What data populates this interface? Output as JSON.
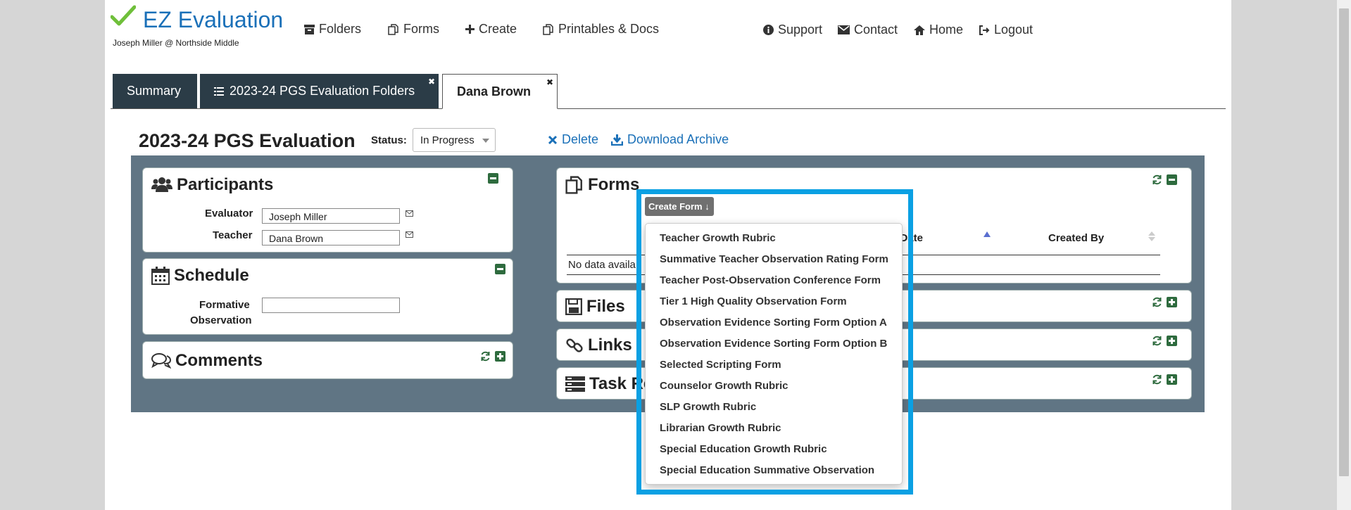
{
  "app": {
    "name": "EZ Evaluation",
    "user_line": "Joseph Miller @ Northside Middle",
    "brand_color": "#1a70b8"
  },
  "nav": {
    "left": [
      {
        "label": "Folders",
        "icon": "archive-icon"
      },
      {
        "label": "Forms",
        "icon": "copy-icon"
      },
      {
        "label": "Create",
        "icon": "plus-icon"
      },
      {
        "label": "Printables & Docs",
        "icon": "copy-icon"
      }
    ],
    "right": [
      {
        "label": "Support",
        "icon": "info-circle-icon"
      },
      {
        "label": "Contact",
        "icon": "envelope-icon"
      },
      {
        "label": "Home",
        "icon": "home-icon"
      },
      {
        "label": "Logout",
        "icon": "logout-icon"
      }
    ]
  },
  "tabs": [
    {
      "label": "Summary",
      "active": false
    },
    {
      "label": "2023-24 PGS Evaluation Folders",
      "active": false,
      "closable": true
    },
    {
      "label": "Dana Brown",
      "active": true,
      "closable": true
    }
  ],
  "evaluation": {
    "title": "2023-24 PGS Evaluation",
    "status_label": "Status:",
    "status_value": "In Progress",
    "delete_label": "Delete",
    "download_label": "Download Archive"
  },
  "participants": {
    "title": "Participants",
    "evaluator_label": "Evaluator",
    "evaluator_value": "Joseph Miller",
    "teacher_label": "Teacher",
    "teacher_value": "Dana Brown"
  },
  "schedule": {
    "title": "Schedule",
    "formative_label_1": "Formative",
    "formative_label_2": "Observation",
    "formative_value": ""
  },
  "comments": {
    "title": "Comments"
  },
  "forms_panel": {
    "title": "Forms",
    "col_date": "e Date",
    "col_created_by": "Created By",
    "no_data": "No data availa"
  },
  "files": {
    "title": "Files"
  },
  "links": {
    "title": "Links"
  },
  "task": {
    "title": "Task Re"
  },
  "create_form": {
    "button": "Create Form ↓",
    "items": [
      "Teacher Growth Rubric",
      "Summative Teacher Observation Rating Form",
      "Teacher Post-Observation Conference Form",
      "Tier 1 High Quality Observation Form",
      "Observation Evidence Sorting Form Option A",
      "Observation Evidence Sorting Form Option B",
      "Selected Scripting Form",
      "Counselor Growth Rubric",
      "SLP Growth Rubric",
      "Librarian Growth Rubric",
      "Special Education Growth Rubric",
      "Special Education Summative Observation"
    ]
  },
  "colors": {
    "highlight": "#0aa0e3",
    "panel_bg": "#607584",
    "tab_dark": "#2b3c47",
    "ctrl_green": "#2e6b3e"
  }
}
